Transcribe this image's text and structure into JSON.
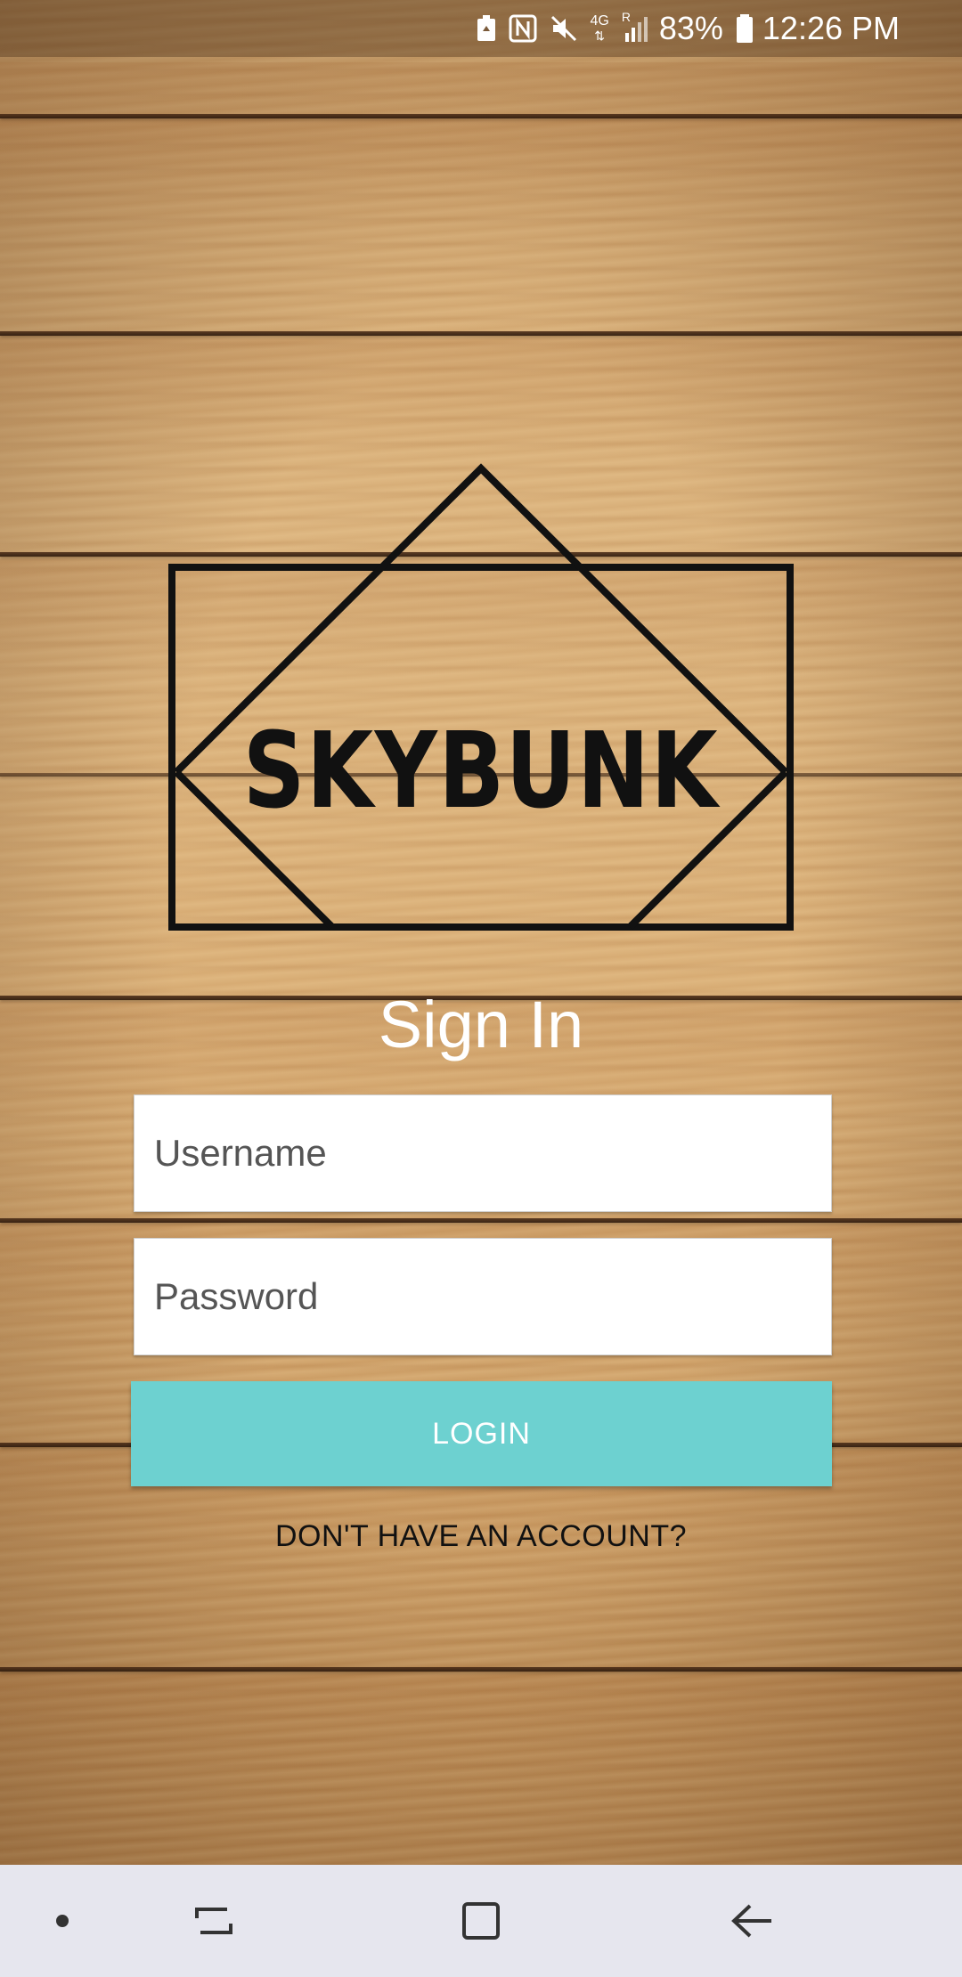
{
  "status_bar": {
    "battery_percent": "83%",
    "time": "12:26 PM",
    "network": "4G",
    "roaming": "R",
    "icons": [
      "battery-saver-icon",
      "nfc-icon",
      "mute-icon",
      "network-4g-icon",
      "signal-icon",
      "battery-icon"
    ]
  },
  "logo": {
    "text": "SKYBUNK"
  },
  "sign_in": {
    "title": "Sign In",
    "username_placeholder": "Username",
    "username_value": "",
    "password_placeholder": "Password",
    "password_value": "",
    "login_label": "LOGIN",
    "signup_link": "DON'T HAVE AN ACCOUNT?"
  },
  "nav_bar": {
    "icons": [
      "dot-icon",
      "recent-apps-icon",
      "home-icon",
      "back-icon"
    ]
  },
  "colors": {
    "login_button": "#6dd1d0",
    "nav_bar": "#e6e6ee",
    "title_text": "#ffffff"
  }
}
